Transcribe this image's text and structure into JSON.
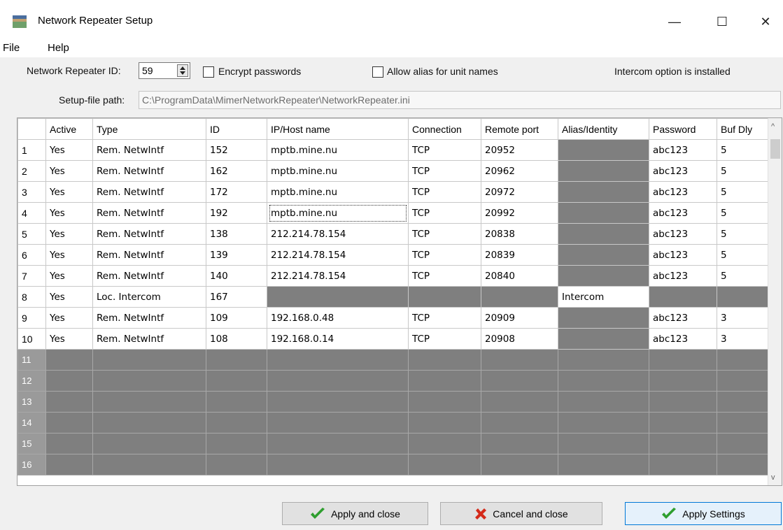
{
  "window": {
    "title": "Network Repeater Setup",
    "minimize": "—",
    "maximize": "☐",
    "close": "✕"
  },
  "menu": [
    "File",
    "Help"
  ],
  "settings": {
    "repeater_id_label": "Network Repeater ID:",
    "repeater_id_value": "59",
    "encrypt_label": "Encrypt passwords",
    "encrypt_checked": false,
    "alias_label": "Allow alias for unit names",
    "alias_checked": false,
    "intercom_status": "Intercom option is installed",
    "setup_path_label": "Setup-file path:",
    "setup_path_value": "C:\\ProgramData\\MimerNetworkRepeater\\NetworkRepeater.ini"
  },
  "grid": {
    "columns": [
      "",
      "Active",
      "Type",
      "ID",
      "IP/Host name",
      "Connection",
      "Remote port",
      "Alias/Identity",
      "Password",
      "Buf Dly"
    ],
    "rows": [
      {
        "n": "1",
        "active": "Yes",
        "type": "Rem. NetwIntf",
        "id": "152",
        "host": "mptb.mine.nu",
        "conn": "TCP",
        "port": "20952",
        "alias": "",
        "pwd": "abc123",
        "buf": "5"
      },
      {
        "n": "2",
        "active": "Yes",
        "type": "Rem. NetwIntf",
        "id": "162",
        "host": "mptb.mine.nu",
        "conn": "TCP",
        "port": "20962",
        "alias": "",
        "pwd": "abc123",
        "buf": "5"
      },
      {
        "n": "3",
        "active": "Yes",
        "type": "Rem. NetwIntf",
        "id": "172",
        "host": "mptb.mine.nu",
        "conn": "TCP",
        "port": "20972",
        "alias": "",
        "pwd": "abc123",
        "buf": "5"
      },
      {
        "n": "4",
        "active": "Yes",
        "type": "Rem. NetwIntf",
        "id": "192",
        "host": "mptb.mine.nu",
        "conn": "TCP",
        "port": "20992",
        "alias": "",
        "pwd": "abc123",
        "buf": "5"
      },
      {
        "n": "5",
        "active": "Yes",
        "type": "Rem. NetwIntf",
        "id": "138",
        "host": "212.214.78.154",
        "conn": "TCP",
        "port": "20838",
        "alias": "",
        "pwd": "abc123",
        "buf": "5"
      },
      {
        "n": "6",
        "active": "Yes",
        "type": "Rem. NetwIntf",
        "id": "139",
        "host": "212.214.78.154",
        "conn": "TCP",
        "port": "20839",
        "alias": "",
        "pwd": "abc123",
        "buf": "5"
      },
      {
        "n": "7",
        "active": "Yes",
        "type": "Rem. NetwIntf",
        "id": "140",
        "host": "212.214.78.154",
        "conn": "TCP",
        "port": "20840",
        "alias": "",
        "pwd": "abc123",
        "buf": "5"
      },
      {
        "n": "8",
        "active": "Yes",
        "type": "Loc. Intercom",
        "id": "167",
        "host": "",
        "conn": "",
        "port": "",
        "alias": "Intercom",
        "pwd": "",
        "buf": ""
      },
      {
        "n": "9",
        "active": "Yes",
        "type": "Rem. NetwIntf",
        "id": "109",
        "host": "192.168.0.48",
        "conn": "TCP",
        "port": "20909",
        "alias": "",
        "pwd": "abc123",
        "buf": "3"
      },
      {
        "n": "10",
        "active": "Yes",
        "type": "Rem. NetwIntf",
        "id": "108",
        "host": "192.168.0.14",
        "conn": "TCP",
        "port": "20908",
        "alias": "",
        "pwd": "abc123",
        "buf": "3"
      }
    ],
    "empty_rows": [
      "11",
      "12",
      "13",
      "14",
      "15",
      "16"
    ]
  },
  "buttons": {
    "apply_close": "Apply and close",
    "cancel_close": "Cancel and close",
    "apply_settings": "Apply Settings"
  },
  "colors": {
    "disabled_cell": "#7f7f7f",
    "check_green": "#2e9e2e",
    "cancel_red": "#d42a1a"
  }
}
